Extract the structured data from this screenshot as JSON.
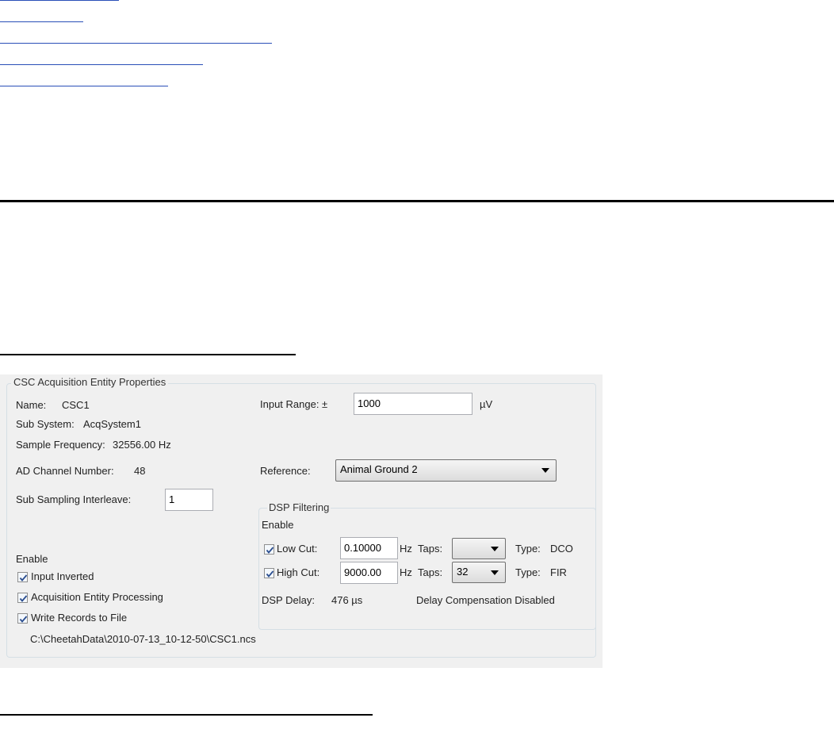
{
  "dialog": {
    "group_title": "CSC Acquisition Entity Properties",
    "name_label": "Name:",
    "name_value": "CSC1",
    "subsystem_label": "Sub System:",
    "subsystem_value": "AcqSystem1",
    "sample_frequency_label": "Sample Frequency:",
    "sample_frequency_value": "32556.00 Hz",
    "ad_channel_label": "AD Channel Number:",
    "ad_channel_value": "48",
    "sub_sampling_label": "Sub Sampling Interleave:",
    "sub_sampling_value": "1",
    "input_range_label": "Input Range: ±",
    "input_range_value": "1000",
    "input_range_unit": "µV",
    "reference_label": "Reference:",
    "reference_value": "Animal Ground 2",
    "enable_label": "Enable",
    "input_inverted_label": "Input Inverted",
    "input_inverted_checked": true,
    "acq_processing_label": "Acquisition Entity Processing",
    "acq_processing_checked": true,
    "write_records_label": "Write Records to File",
    "write_records_checked": true,
    "file_path": "C:\\CheetahData\\2010-07-13_10-12-50\\CSC1.ncs"
  },
  "dsp": {
    "group_title": "DSP Filtering",
    "enable_label": "Enable",
    "low_cut_label": "Low Cut:",
    "low_cut_checked": true,
    "low_cut_value": "0.10000",
    "low_cut_unit": "Hz",
    "low_taps_label": "Taps:",
    "low_taps_value": "",
    "low_type_label": "Type:",
    "low_type_value": "DCO",
    "high_cut_label": "High Cut:",
    "high_cut_checked": true,
    "high_cut_value": "9000.00",
    "high_cut_unit": "Hz",
    "high_taps_label": "Taps:",
    "high_taps_value": "32",
    "high_type_label": "Type:",
    "high_type_value": "FIR",
    "delay_label": "DSP Delay:",
    "delay_value": "476 µs",
    "delay_compensation": "Delay Compensation Disabled"
  }
}
